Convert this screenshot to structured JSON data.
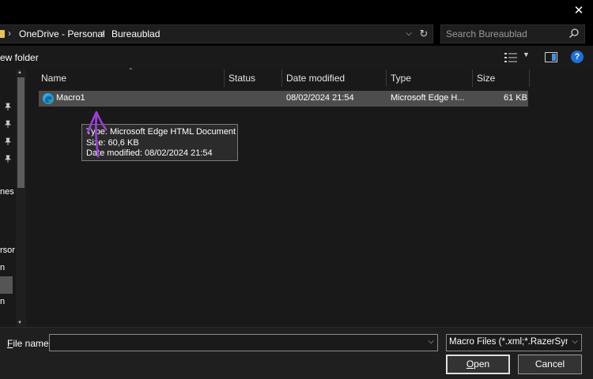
{
  "titlebar": {
    "close_glyph": "✕"
  },
  "address": {
    "crumbs": [
      "OneDrive - Personal",
      "Bureaublad"
    ],
    "separator": "›"
  },
  "search": {
    "placeholder": "Search Bureaublad"
  },
  "toolbar": {
    "new_folder_label": "ew folder"
  },
  "nav": {
    "fragments": [
      "nes",
      "rsor",
      "n",
      "n"
    ]
  },
  "columns": {
    "name": "Name",
    "status": "Status",
    "date_modified": "Date modified",
    "type": "Type",
    "size": "Size"
  },
  "files": [
    {
      "name": "Macro1",
      "status": "",
      "date_modified": "08/02/2024 21:54",
      "type": "Microsoft Edge H...",
      "size": "61 KB"
    }
  ],
  "tooltip": {
    "type_line": "Type: Microsoft Edge HTML Document",
    "size_line": "Size: 60,6 KB",
    "date_line": "Date modified: 08/02/2024 21:54"
  },
  "bottom": {
    "file_name_label": "File name:",
    "file_name_value": "",
    "file_type_value": "Macro Files (*.xml;*.RazerSynapse)",
    "open_label": "Open",
    "cancel_label": "Cancel"
  },
  "colors": {
    "annotation_arrow": "#9b3fd6",
    "help_icon": "#1e6fd9",
    "selection": "#4d4d4d"
  }
}
